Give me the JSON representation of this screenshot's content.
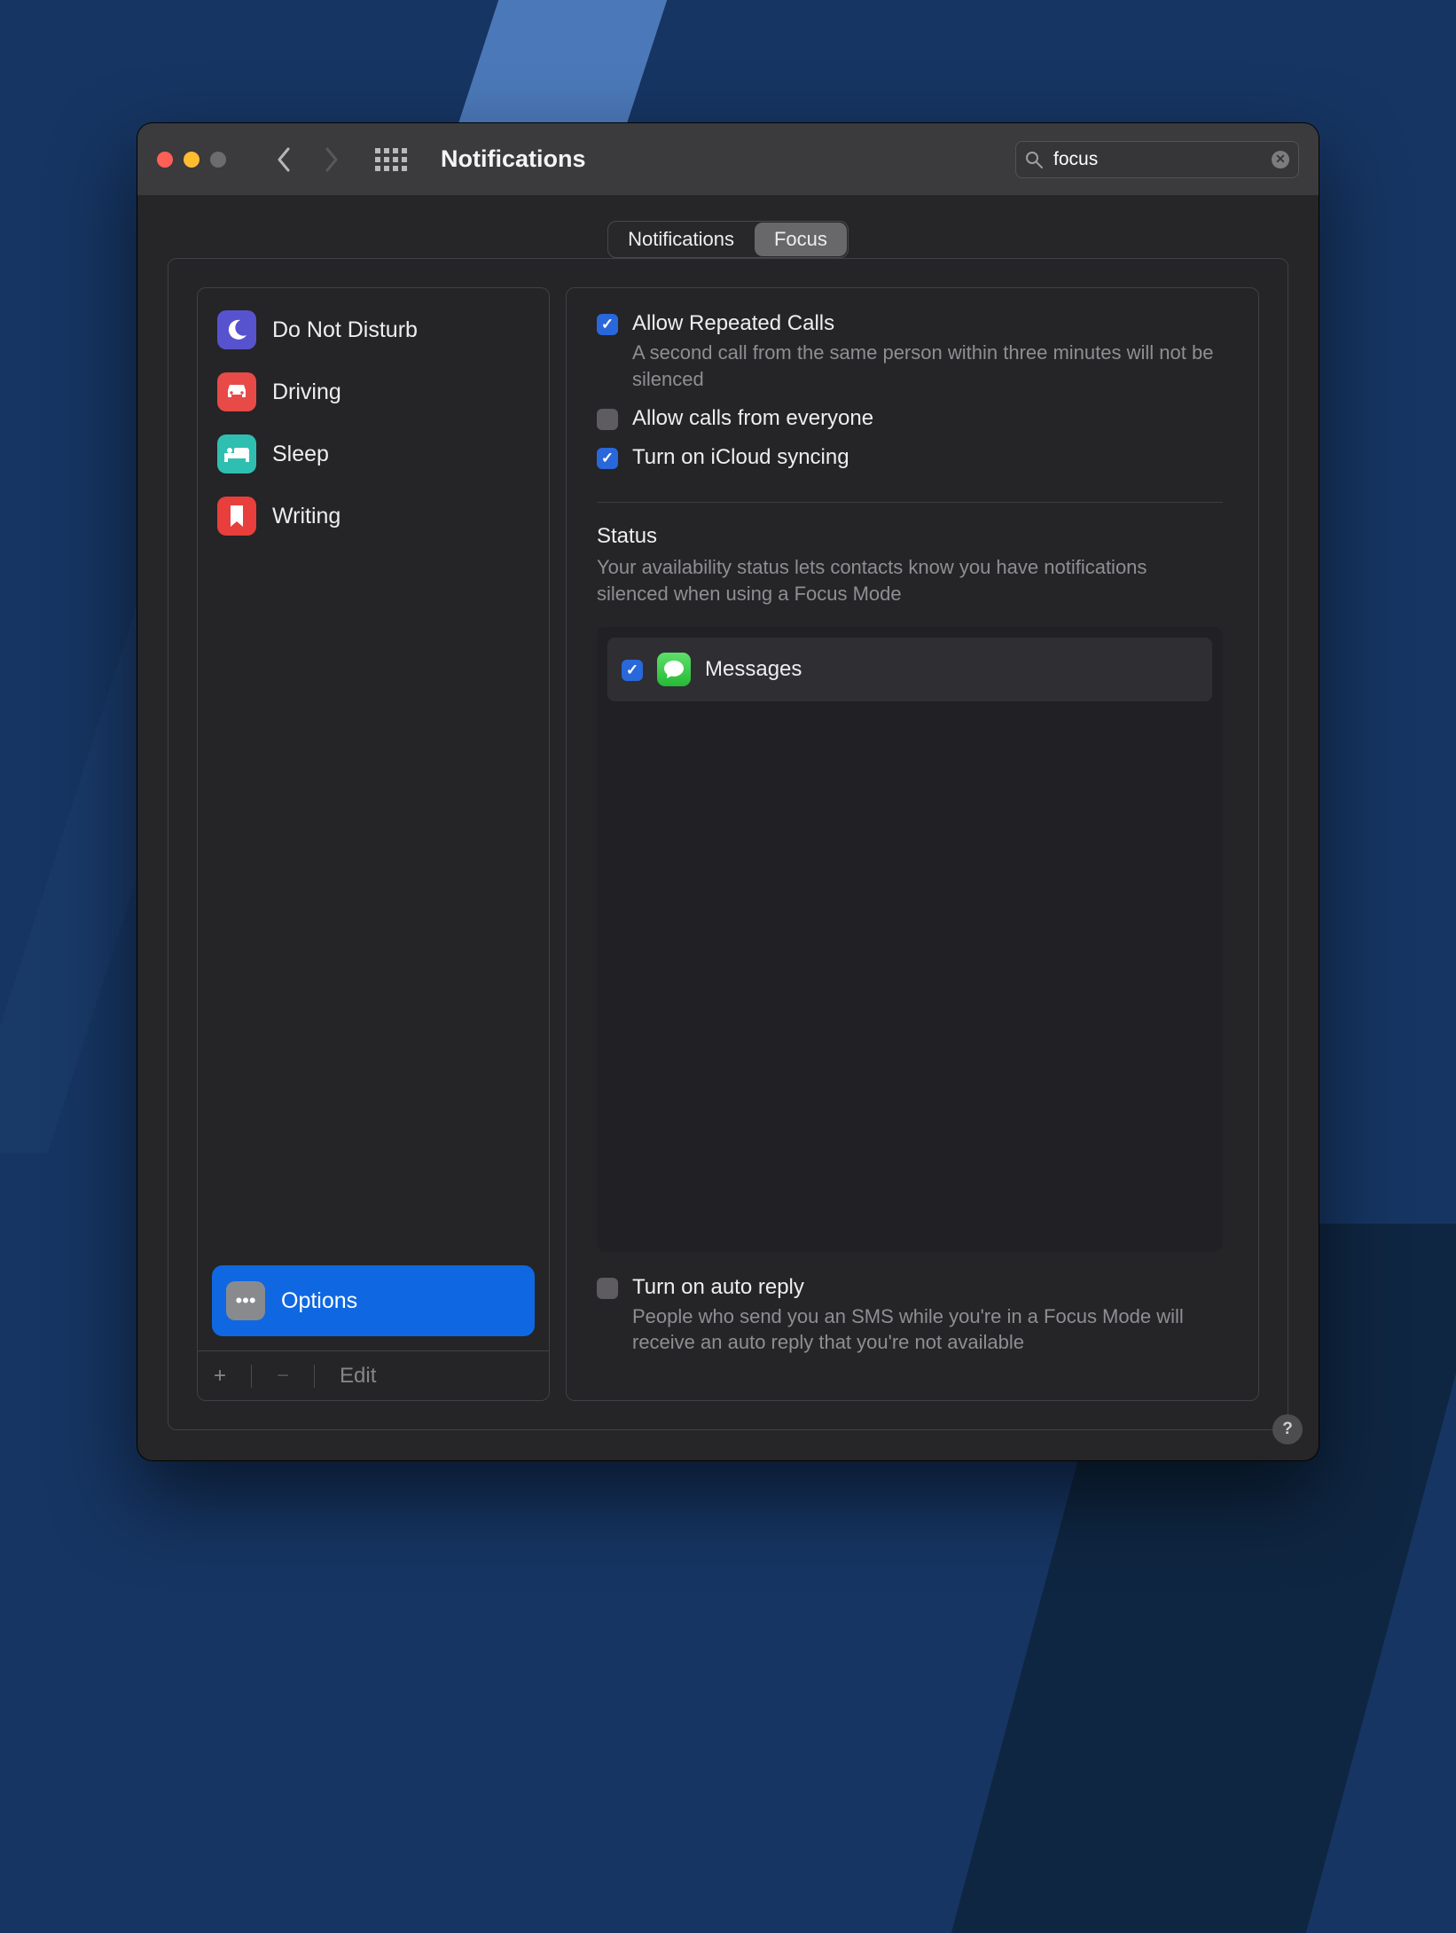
{
  "window": {
    "title": "Notifications"
  },
  "search": {
    "value": "focus",
    "clear_icon": "clear-icon"
  },
  "tabs": [
    {
      "label": "Notifications",
      "active": false
    },
    {
      "label": "Focus",
      "active": true
    }
  ],
  "sidebar": {
    "modes": [
      {
        "label": "Do Not Disturb",
        "icon": "moon-icon",
        "color": "#5753cf"
      },
      {
        "label": "Driving",
        "icon": "car-icon",
        "color": "#e84a48"
      },
      {
        "label": "Sleep",
        "icon": "bed-icon",
        "color": "#2fbfb1"
      },
      {
        "label": "Writing",
        "icon": "bookmark-icon",
        "color": "#e83f3c"
      }
    ],
    "options_row": {
      "label": "Options",
      "icon": "ellipsis-icon"
    },
    "footer": {
      "add": "+",
      "remove": "−",
      "edit": "Edit"
    }
  },
  "pane": {
    "options": [
      {
        "label": "Allow Repeated Calls",
        "checked": true,
        "desc": "A second call from the same person within three minutes will not be silenced"
      },
      {
        "label": "Allow calls from everyone",
        "checked": false,
        "desc": ""
      },
      {
        "label": "Turn on iCloud syncing",
        "checked": true,
        "desc": ""
      }
    ],
    "status": {
      "title": "Status",
      "desc": "Your availability status lets contacts know you have notifications silenced when using a Focus Mode",
      "apps": [
        {
          "label": "Messages",
          "checked": true,
          "icon": "messages-icon"
        }
      ]
    },
    "auto_reply": {
      "label": "Turn on auto reply",
      "checked": false,
      "desc": "People who send you an SMS while you're in a Focus Mode will receive an auto reply that you're not available"
    }
  },
  "help_icon": "?"
}
